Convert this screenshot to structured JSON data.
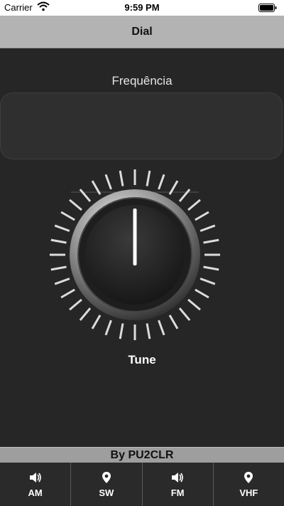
{
  "status_bar": {
    "carrier": "Carrier",
    "time": "9:59 PM",
    "wifi_icon": "wifi-icon",
    "battery_icon": "battery-icon"
  },
  "nav": {
    "title": "Dial"
  },
  "main": {
    "frequency_label": "Frequência",
    "frequency_value": "",
    "knob_label": "Tune"
  },
  "footer": {
    "text": "By PU2CLR"
  },
  "tabs": [
    {
      "label": "AM",
      "icon": "speaker-icon"
    },
    {
      "label": "SW",
      "icon": "location-pin-icon"
    },
    {
      "label": "FM",
      "icon": "speaker-icon"
    },
    {
      "label": "VHF",
      "icon": "location-pin-icon"
    }
  ],
  "colors": {
    "background": "#262626",
    "nav_bar": "#b3b3b3",
    "footer_bar": "#9e9e9e",
    "tab_bar": "#2a2a2a"
  }
}
